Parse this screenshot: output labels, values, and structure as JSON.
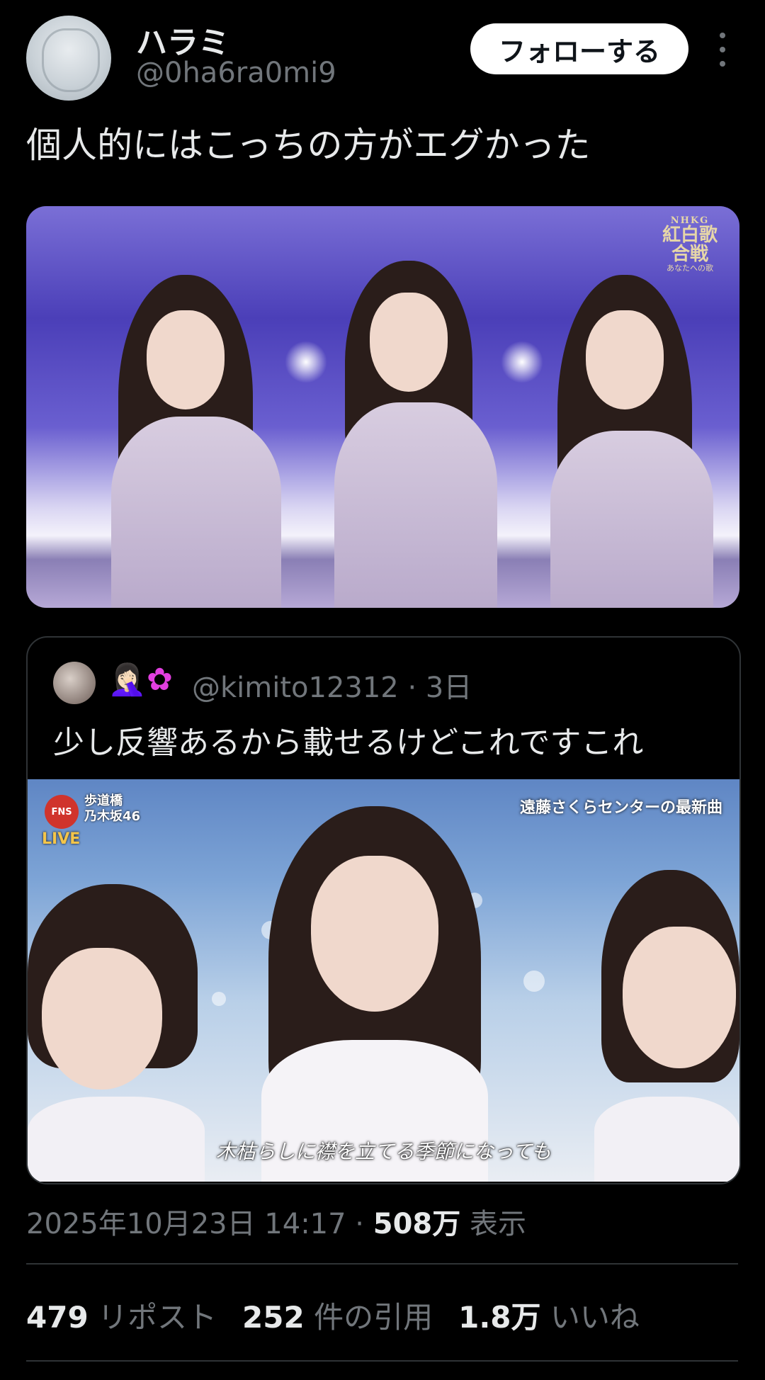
{
  "author": {
    "name": "ハラミ",
    "handle": "@0ha6ra0mi9",
    "follow_label": "フォローする"
  },
  "tweet": {
    "text": "個人的にはこっちの方がエグかった",
    "timestamp": "2025年10月23日 14:17 · ",
    "views_count": "508万",
    "views_label": " 表示"
  },
  "media1": {
    "logo_small": "NHKG",
    "logo_main": "紅白歌合戦",
    "logo_sub": "あなたへの歌"
  },
  "quote": {
    "emoji1": "🤦🏻‍♀️",
    "emoji2": "✿",
    "handle_meta": "@kimito12312 · 3日",
    "text": "少し反響あるから載せるけどこれですこれ",
    "media": {
      "fns_logo": "FNS",
      "program_line1": "歩道橋",
      "program_line2": "乃木坂46",
      "live": "LIVE",
      "caption_top": "遠藤さくらセンターの最新曲",
      "subtitle": "木枯らしに襟を立てる季節になっても"
    }
  },
  "stats": {
    "reposts_count": "479",
    "reposts_label": "リポスト",
    "quotes_count": "252",
    "quotes_label": "件の引用",
    "likes_count": "1.8万",
    "likes_label": "いいね"
  },
  "colors": {
    "background": "#000000",
    "text_primary": "#e7e9ea",
    "text_secondary": "#71767b",
    "border": "#2f3336"
  }
}
